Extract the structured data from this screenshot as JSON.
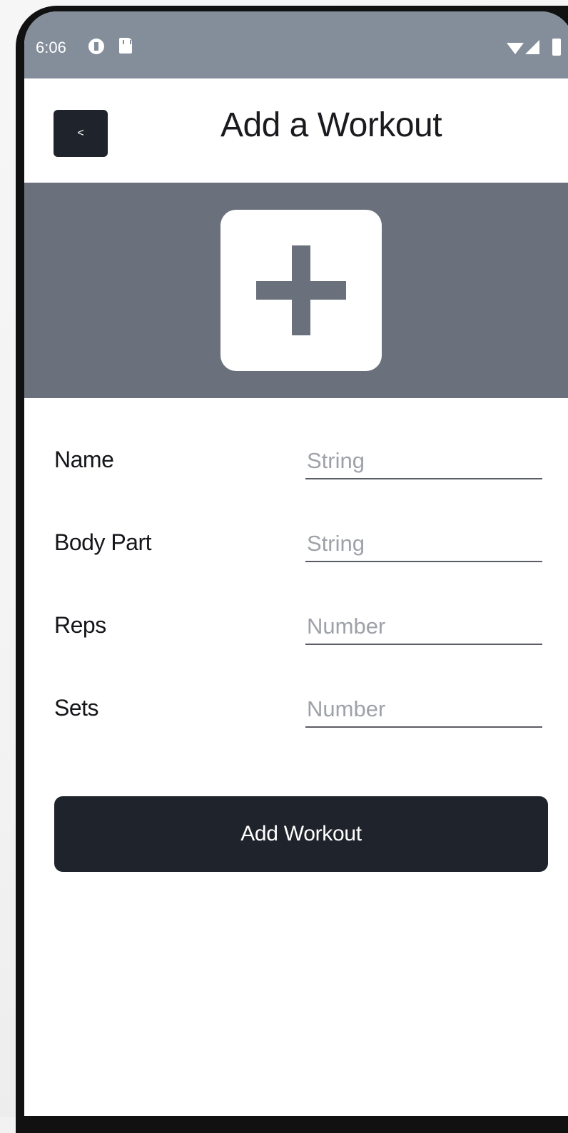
{
  "status_bar": {
    "time": "6:06",
    "icons": [
      "notification-c-icon",
      "sd-card-icon",
      "wifi-icon",
      "signal-icon",
      "battery-icon"
    ]
  },
  "header": {
    "back_label": "<",
    "title": "Add a Workout"
  },
  "banner": {
    "icon": "plus-icon"
  },
  "form": {
    "fields": [
      {
        "label": "Name",
        "placeholder": "String",
        "value": ""
      },
      {
        "label": "Body Part",
        "placeholder": "String",
        "value": ""
      },
      {
        "label": "Reps",
        "placeholder": "Number",
        "value": ""
      },
      {
        "label": "Sets",
        "placeholder": "Number",
        "value": ""
      }
    ],
    "submit_label": "Add Workout"
  },
  "colors": {
    "status_bar": "#848e9b",
    "banner": "#6b717c",
    "button": "#1f232b",
    "text": "#15161a",
    "placeholder": "#9ea2a8"
  }
}
